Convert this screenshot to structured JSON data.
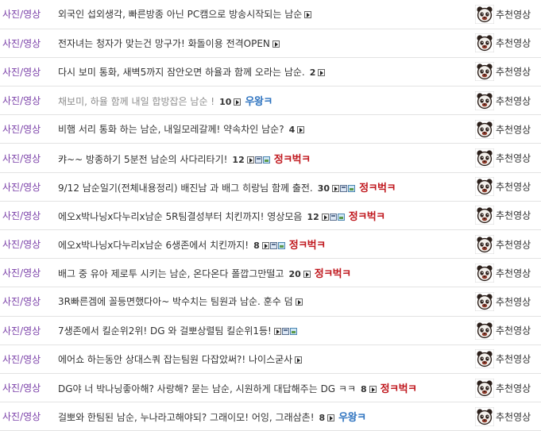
{
  "rows": [
    {
      "category": "사진/영상",
      "title": "외국인 섭외생각, 빠른방종 아닌 PC캠으로 방송시작되는 남순",
      "count": "",
      "icons": [
        "video"
      ],
      "badge": "",
      "badge_color": "",
      "writer": "추천영상",
      "dim": false
    },
    {
      "category": "사진/영상",
      "title": "전자녀는 청자가 맞는건 망구가! 화돌이용 전격OPEN",
      "count": "",
      "icons": [
        "video"
      ],
      "badge": "",
      "badge_color": "",
      "writer": "추천영상",
      "dim": false
    },
    {
      "category": "사진/영상",
      "title": "다시 보미 통화, 새벽5까지 잠안오면 하율과 함께 오라는 남순.",
      "count": "2",
      "icons": [
        "video"
      ],
      "badge": "",
      "badge_color": "",
      "writer": "추천영상",
      "dim": false
    },
    {
      "category": "사진/영상",
      "title": "채보미, 하율 함께 내일 합방잡은 남순 !",
      "count": "10",
      "icons": [
        "video"
      ],
      "badge": "우왕ㅋ",
      "badge_color": "#2f74c0",
      "writer": "추천영상",
      "dim": true
    },
    {
      "category": "사진/영상",
      "title": "비햄 서리 통화 하는 남순, 내일모레갈께! 약속차인 남순?",
      "count": "4",
      "icons": [
        "video"
      ],
      "badge": "",
      "badge_color": "",
      "writer": "추천영상",
      "dim": false
    },
    {
      "category": "사진/영상",
      "title": "캬~~ 방종하기 5분전 남순의 사다리타기!",
      "count": "12",
      "icons": [
        "video",
        "save",
        "image"
      ],
      "badge": "정ㅋ벅ㅋ",
      "badge_color": "#c0181e",
      "writer": "추천영상",
      "dim": false
    },
    {
      "category": "사진/영상",
      "title": "9/12 남순일기(전체내용정리) 배진남 과 배그 히랑님 함께 출전.",
      "count": "30",
      "icons": [
        "video",
        "save",
        "image"
      ],
      "badge": "정ㅋ벅ㅋ",
      "badge_color": "#c0181e",
      "writer": "추천영상",
      "dim": false
    },
    {
      "category": "사진/영상",
      "title": "에오x박나닝x다누리x남순 5R팀결성부터 치킨까지! 영상모음",
      "count": "12",
      "icons": [
        "video",
        "save",
        "image"
      ],
      "badge": "정ㅋ벅ㅋ",
      "badge_color": "#c0181e",
      "writer": "추천영상",
      "dim": false
    },
    {
      "category": "사진/영상",
      "title": "에오x박나닝x다누리x남순 6생존에서 치킨까지!",
      "count": "8",
      "icons": [
        "video",
        "save",
        "image"
      ],
      "badge": "정ㅋ벅ㅋ",
      "badge_color": "#c0181e",
      "writer": "추천영상",
      "dim": false
    },
    {
      "category": "사진/영상",
      "title": "배그 중 유아 제로투 시키는 남순, 온다온다 폴깝그만떨고",
      "count": "20",
      "icons": [
        "video"
      ],
      "badge": "정ㅋ벅ㅋ",
      "badge_color": "#c0181e",
      "writer": "추천영상",
      "dim": false
    },
    {
      "category": "사진/영상",
      "title": "3R빠른겜에 꼴등면했다아~ 박수치는 팀원과 남순. 훈수 덤",
      "count": "",
      "icons": [
        "video"
      ],
      "badge": "",
      "badge_color": "",
      "writer": "추천영상",
      "dim": false
    },
    {
      "category": "사진/영상",
      "title": "7생존에서 킬순위2위! DG 와 걸뽀상렬팀 킬순위1등!",
      "count": "",
      "icons": [
        "video",
        "save",
        "image"
      ],
      "badge": "",
      "badge_color": "",
      "writer": "추천영상",
      "dim": false
    },
    {
      "category": "사진/영상",
      "title": "에어쇼 하는동안 상대스쿼 잡는팀원 다잡았써?! 나이스굳사",
      "count": "",
      "icons": [
        "video"
      ],
      "badge": "",
      "badge_color": "",
      "writer": "추천영상",
      "dim": false
    },
    {
      "category": "사진/영상",
      "title": "DG야 너 박나닝좋아해? 사랑해? 묻는 남순, 시원하게 대답해주는 DG ㅋㅋ",
      "count": "8",
      "icons": [
        "video"
      ],
      "badge": "정ㅋ벅ㅋ",
      "badge_color": "#c0181e",
      "writer": "추천영상",
      "dim": false
    },
    {
      "category": "사진/영상",
      "title": "걸뽀와 한팀된 남순, 누나라고해야되? 그래이모! 어잉, 그래삼촌!",
      "count": "8",
      "icons": [
        "video"
      ],
      "badge": "우왕ㅋ",
      "badge_color": "#2f74c0",
      "writer": "추천영상",
      "dim": false
    }
  ]
}
